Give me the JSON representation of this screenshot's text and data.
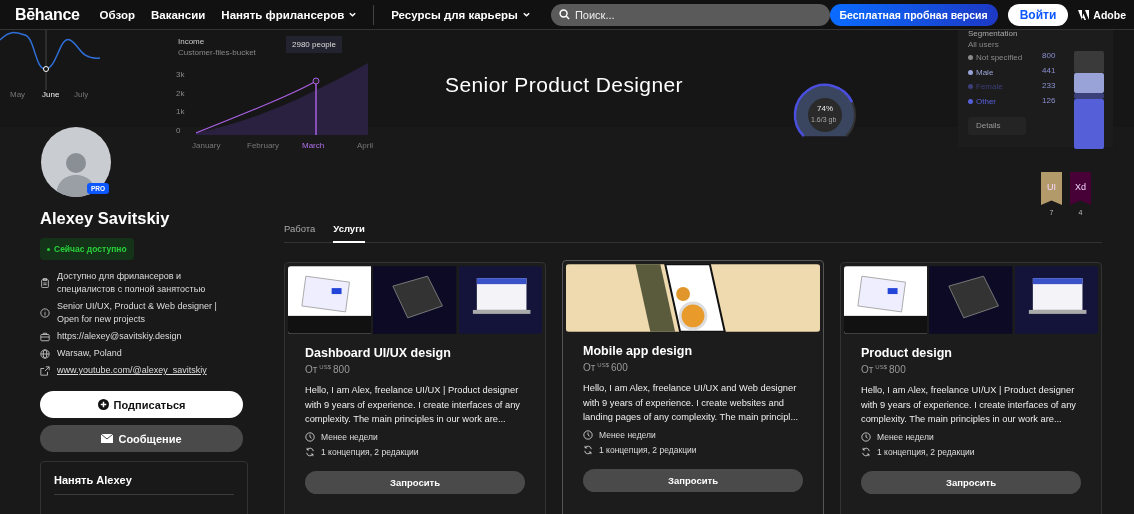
{
  "header": {
    "logo": "Bēhance",
    "nav": [
      {
        "label": "Обзор",
        "dropdown": false
      },
      {
        "label": "Вакансии",
        "dropdown": false
      },
      {
        "label": "Нанять фрилансеров",
        "dropdown": true
      },
      {
        "label": "Ресурсы для карьеры",
        "dropdown": true
      }
    ],
    "search": {
      "placeholder": "Поиск..."
    },
    "trial_button": "Бесплатная пробная версия",
    "login_button": "Войти",
    "adobe": "Adobe"
  },
  "cover": {
    "title": "Senior Product Designer",
    "line_widget": {
      "x_labels": [
        {
          "label": "May",
          "selected": false
        },
        {
          "label": "June",
          "selected": true
        },
        {
          "label": "July",
          "selected": false
        }
      ]
    },
    "income_widget": {
      "title": "Income",
      "subtitle": "Customer-files-bucket",
      "tooltip": "2980 people",
      "y_labels": [
        "3k",
        "2k",
        "1k",
        "0"
      ],
      "x_labels": [
        {
          "label": "January",
          "selected": false
        },
        {
          "label": "February",
          "selected": false
        },
        {
          "label": "March",
          "selected": true
        },
        {
          "label": "April",
          "selected": false
        }
      ]
    },
    "gauge": {
      "value": "74%",
      "caption": "1.6/3 gb",
      "level": 0.74
    },
    "segmentation": {
      "title": "Segmentation",
      "subtitle": "All users",
      "legend": [
        {
          "label": "Not specified",
          "color": "#8a8a8a"
        },
        {
          "label": "Male",
          "color": "#9aa3d8"
        },
        {
          "label": "Female",
          "color": "#3b3f7a"
        },
        {
          "label": "Other",
          "color": "#5560d8"
        }
      ],
      "values": [
        "800",
        "441",
        "233",
        "126"
      ],
      "button": "Details"
    }
  },
  "profile": {
    "name": "Alexey Savitskiy",
    "pro_badge": "PRO",
    "status": "Сейчас доступно",
    "info": [
      {
        "kind": "clipboard",
        "text": "Доступно для фрилансеров и специалистов с полной занятостью",
        "link": false
      },
      {
        "kind": "info",
        "text": "Senior UI/UX, Product & Web designer | Open for new projects",
        "link": false
      },
      {
        "kind": "briefcase",
        "text": "https://alexey@savitskiy.design",
        "link": false
      },
      {
        "kind": "globe",
        "text": "Warsaw, Poland",
        "link": false
      },
      {
        "kind": "share",
        "text": "www.youtube.com/@alexey_savitskiy",
        "link": true
      }
    ],
    "follow_button": "Подписаться",
    "message_button": "Сообщение",
    "hire_title": "Нанять Alexey"
  },
  "ribbons": [
    {
      "label": "UI",
      "count": "7",
      "color": "#b39a6a"
    },
    {
      "label": "Xd",
      "count": "4",
      "color": "#470137"
    }
  ],
  "tabs": [
    {
      "label": "Работа",
      "selected": false
    },
    {
      "label": "Услуги",
      "selected": true
    }
  ],
  "services": [
    {
      "kind": "laptops",
      "title": "Dashboard UI/UX design",
      "prefix": "От",
      "currency": "US$",
      "amount": "800",
      "description": "Hello, I am Alex, freelance UI/UX | Product designer with 9 years of experience. I create interfaces of any complexity. The main principles in our work are...",
      "duration": "Менее недели",
      "revisions": "1 концепция, 2 редакции",
      "button": "Запросить",
      "selected": false
    },
    {
      "kind": "phone",
      "title": "Mobile app design",
      "prefix": "От",
      "currency": "US$",
      "amount": "600",
      "description": "Hello, I am Alex, freelance UI/UX and Web designer with 9 years of experience. I create websites and landing pages of any complexity. The main principl...",
      "duration": "Менее недели",
      "revisions": "1 концепция, 2 редакции",
      "button": "Запросить",
      "selected": true
    },
    {
      "kind": "laptops",
      "title": "Product design",
      "prefix": "От",
      "currency": "US$",
      "amount": "800",
      "description": "Hello, I am Alex, freelance UI/UX | Product designer with 9 years of experience. I create interfaces of any complexity. The main principles in our work are...",
      "duration": "Менее недели",
      "revisions": "1 концепция, 2 редакции",
      "button": "Запросить",
      "selected": false
    }
  ]
}
